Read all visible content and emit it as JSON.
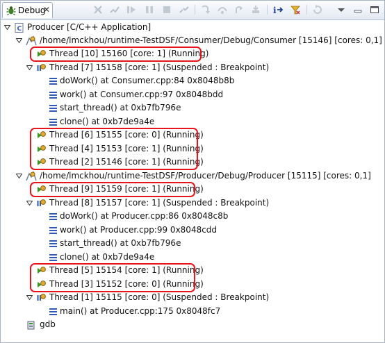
{
  "view": {
    "title": "Debug",
    "close_glyph": "✕"
  },
  "toolbar": {
    "buttons": [
      {
        "name": "remove-terminated-icon"
      },
      {
        "name": "connect-icon"
      },
      {
        "name": "resume-icon"
      },
      {
        "name": "suspend-icon"
      },
      {
        "name": "terminate-icon"
      },
      {
        "name": "disconnect-icon"
      },
      {
        "name": "step-into-icon"
      },
      {
        "name": "step-over-icon"
      },
      {
        "name": "step-return-icon"
      },
      {
        "name": "drop-to-frame-icon"
      },
      {
        "name": "instruction-stepping-icon"
      },
      {
        "name": "use-step-filters-icon"
      },
      {
        "name": "reset-icon"
      },
      {
        "name": "view-menu-icon"
      }
    ]
  },
  "colors": {
    "highlight": "#e8141c",
    "accent": "#2f59b5",
    "thread_running": "#3a9a28"
  },
  "tree": {
    "launch": "Producer [C/C++ Application]",
    "consumer": {
      "process": "/home/lmckhou/runtime-TestDSF/Consumer/Debug/Consumer [15146] [cores: 0,1]",
      "thread10": "Thread [10] 15160 [core: 1] (Running)",
      "thread7": "Thread [7] 15158 [core: 1] (Suspended : Breakpoint)",
      "frames": [
        "doWork() at Consumer.cpp:84 0x8048b8b",
        "work() at Consumer.cpp:97 0x8048bdd",
        "start_thread() at 0xb7fb796e",
        "clone() at 0xb7de9a4e"
      ],
      "thread6": "Thread [6] 15155 [core: 0] (Running)",
      "thread4": "Thread [4] 15153 [core: 1] (Running)",
      "thread2": "Thread [2] 15146 [core: 1] (Running)"
    },
    "producer": {
      "process": "/home/lmckhou/runtime-TestDSF/Producer/Debug/Producer [15115] [cores: 0,1]",
      "thread9": "Thread [9] 15159 [core: 1] (Running)",
      "thread8": "Thread [8] 15157 [core: 1] (Suspended : Breakpoint)",
      "frames": [
        "doWork() at Producer.cpp:86 0x8048c8b",
        "work() at Producer.cpp:99 0x8048cdd",
        "start_thread() at 0xb7fb796e",
        "clone() at 0xb7de9a4e"
      ],
      "thread5": "Thread [5] 15154 [core: 1] (Running)",
      "thread3": "Thread [3] 15152 [core: 0] (Running)",
      "thread1": "Thread [1] 15115 [core: 0] (Suspended : Breakpoint)",
      "thread1_frames": [
        "main() at Producer.cpp:175 0x8048fc7"
      ]
    },
    "gdb": "gdb"
  }
}
